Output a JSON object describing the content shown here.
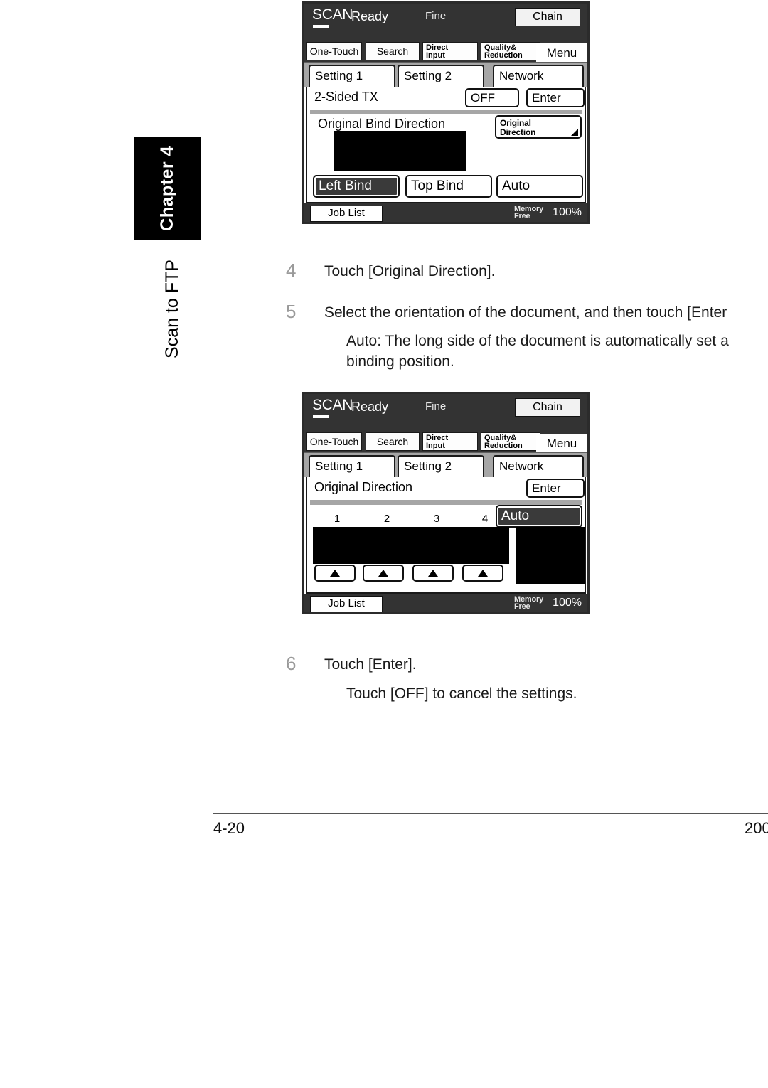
{
  "sidebar": {
    "chapter_label": "Chapter 4",
    "section_label": "Scan to FTP"
  },
  "panel1": {
    "header": {
      "mode": "SCAN",
      "status": "Ready",
      "resolution": "Fine",
      "chain": "Chain"
    },
    "function_buttons": [
      "One-Touch",
      "Search",
      "Direct Input",
      "Quality& Reduction",
      "Menu"
    ],
    "fn_direct_line1": "Direct",
    "fn_direct_line2": "Input",
    "fn_quality_line1": "Quality&",
    "fn_quality_line2": "Reduction",
    "tabs": [
      "Setting 1",
      "Setting 2",
      "Network"
    ],
    "active_tab": "Setting 1",
    "row_title": "2-Sided TX",
    "off_button": "OFF",
    "enter_button": "Enter",
    "section_label": "Original Bind Direction",
    "dropdown_line1": "Original",
    "dropdown_line2": "Direction",
    "choices": [
      "Left Bind",
      "Top Bind",
      "Auto"
    ],
    "selected_choice": "Left Bind",
    "status": {
      "job_list": "Job List",
      "memory_line1": "Memory",
      "memory_line2": "Free",
      "memory_percent": "100%"
    }
  },
  "panel2": {
    "header": {
      "mode": "SCAN",
      "status": "Ready",
      "resolution": "Fine",
      "chain": "Chain"
    },
    "function_buttons": [
      "One-Touch",
      "Search",
      "Direct Input",
      "Quality& Reduction",
      "Menu"
    ],
    "fn_direct_line1": "Direct",
    "fn_direct_line2": "Input",
    "fn_quality_line1": "Quality&",
    "fn_quality_line2": "Reduction",
    "tabs": [
      "Setting 1",
      "Setting 2",
      "Network"
    ],
    "active_tab": "Setting 1",
    "row_title": "Original Direction",
    "enter_button": "Enter",
    "auto_button": "Auto",
    "selected_choice": "Auto",
    "orientation_numbers": [
      "1",
      "2",
      "3",
      "4"
    ],
    "status": {
      "job_list": "Job List",
      "memory_line1": "Memory",
      "memory_line2": "Free",
      "memory_percent": "100%"
    }
  },
  "steps": [
    {
      "number": "4",
      "text": "Touch [Original Direction]."
    },
    {
      "number": "5",
      "text": "Select the orientation of the document, and then touch [Enter"
    },
    {
      "number": "6",
      "text": "Touch [Enter]."
    }
  ],
  "notes": {
    "step5_note_line1": "Auto: The long side of the document is automatically set a",
    "step5_note_line2": "binding position.",
    "step6_note": "Touch [OFF] to cancel the settings."
  },
  "footer": {
    "page_number": "4-20",
    "right_text": "200"
  }
}
